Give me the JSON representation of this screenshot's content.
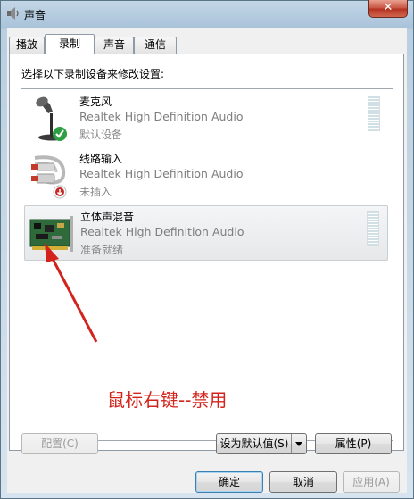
{
  "window": {
    "title": "声音",
    "close_label": "✕"
  },
  "tabs": [
    {
      "label": "播放"
    },
    {
      "label": "录制"
    },
    {
      "label": "声音"
    },
    {
      "label": "通信"
    }
  ],
  "instruction": "选择以下录制设备来修改设置:",
  "devices": [
    {
      "name": "麦克风",
      "driver": "Realtek High Definition Audio",
      "status": "默认设备",
      "icon": "microphone-icon",
      "badge": "green-check"
    },
    {
      "name": "线路输入",
      "driver": "Realtek High Definition Audio",
      "status": "未插入",
      "icon": "line-in-cable-icon",
      "badge": "red-down-arrow"
    },
    {
      "name": "立体声混音",
      "driver": "Realtek High Definition Audio",
      "status": "准备就绪",
      "icon": "sound-card-icon",
      "badge": "none"
    }
  ],
  "annotation": "鼠标右键--禁用",
  "buttons": {
    "configure": "配置(C)",
    "set_default": "设为默认值(S)",
    "properties": "属性(P)",
    "ok": "确定",
    "cancel": "取消",
    "apply": "应用(A)"
  },
  "colors": {
    "annotation": "#d2231c",
    "accent_close": "#c7513f"
  }
}
